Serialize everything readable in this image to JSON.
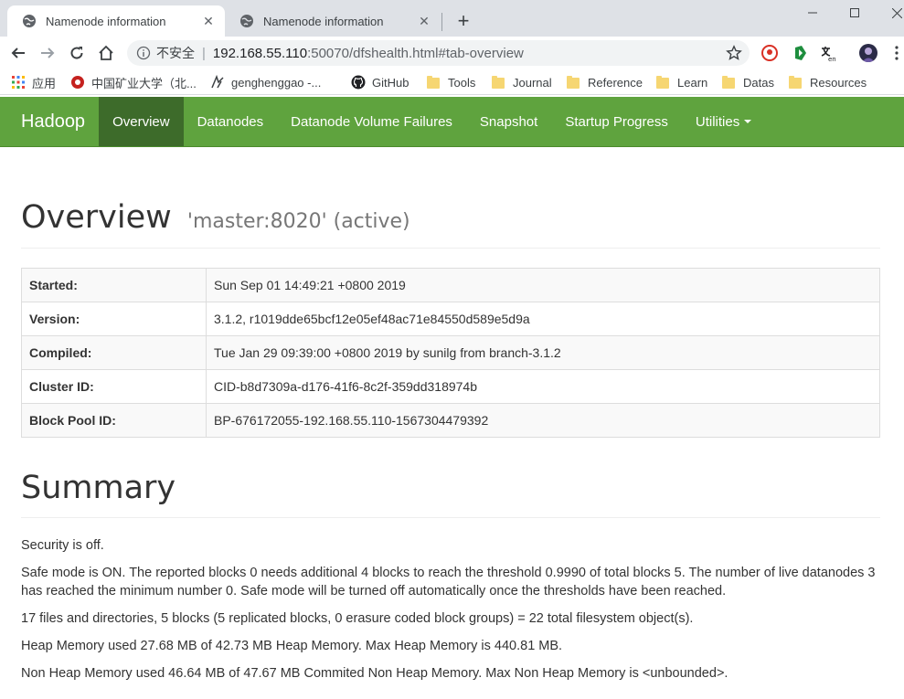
{
  "browser": {
    "tabs": [
      {
        "title": "Namenode information",
        "active": true
      },
      {
        "title": "Namenode information",
        "active": false
      }
    ],
    "address": {
      "security_label": "不安全",
      "host": "192.168.55.110",
      "path": ":50070/dfshealth.html#tab-overview"
    },
    "bookmarks": [
      {
        "label": "应用",
        "icon": "apps-grid-icon"
      },
      {
        "label": "中国矿业大学（北...",
        "icon": "university-icon"
      },
      {
        "label": "genghenggao -...",
        "icon": "profile-icon"
      },
      {
        "label": "GitHub",
        "icon": "github-icon"
      },
      {
        "label": "Tools",
        "icon": "folder-icon"
      },
      {
        "label": "Journal",
        "icon": "folder-icon"
      },
      {
        "label": "Reference",
        "icon": "folder-icon"
      },
      {
        "label": "Learn",
        "icon": "folder-icon"
      },
      {
        "label": "Datas",
        "icon": "folder-icon"
      },
      {
        "label": "Resources",
        "icon": "folder-icon"
      }
    ]
  },
  "navbar": {
    "brand": "Hadoop",
    "items": [
      {
        "label": "Overview",
        "active": true
      },
      {
        "label": "Datanodes"
      },
      {
        "label": "Datanode Volume Failures"
      },
      {
        "label": "Snapshot"
      },
      {
        "label": "Startup Progress"
      },
      {
        "label": "Utilities"
      }
    ],
    "color": "#5fa33e"
  },
  "overview": {
    "title": "Overview",
    "subtitle": "'master:8020' (active)",
    "rows": [
      {
        "key": "Started:",
        "value": "Sun Sep 01 14:49:21 +0800 2019"
      },
      {
        "key": "Version:",
        "value": "3.1.2, r1019dde65bcf12e05ef48ac71e84550d589e5d9a"
      },
      {
        "key": "Compiled:",
        "value": "Tue Jan 29 09:39:00 +0800 2019 by sunilg from branch-3.1.2"
      },
      {
        "key": "Cluster ID:",
        "value": "CID-b8d7309a-d176-41f6-8c2f-359dd318974b"
      },
      {
        "key": "Block Pool ID:",
        "value": "BP-676172055-192.168.55.110-1567304479392"
      }
    ]
  },
  "summary": {
    "title": "Summary",
    "lines": [
      "Security is off.",
      "Safe mode is ON. The reported blocks 0 needs additional 4 blocks to reach the threshold 0.9990 of total blocks 5. The number of live datanodes 3 has reached the minimum number 0. Safe mode will be turned off automatically once the thresholds have been reached.",
      "17 files and directories, 5 blocks (5 replicated blocks, 0 erasure coded block groups) = 22 total filesystem object(s).",
      "Heap Memory used 27.68 MB of 42.73 MB Heap Memory. Max Heap Memory is 440.81 MB.",
      "Non Heap Memory used 46.64 MB of 47.67 MB Commited Non Heap Memory. Max Non Heap Memory is <unbounded>."
    ]
  }
}
